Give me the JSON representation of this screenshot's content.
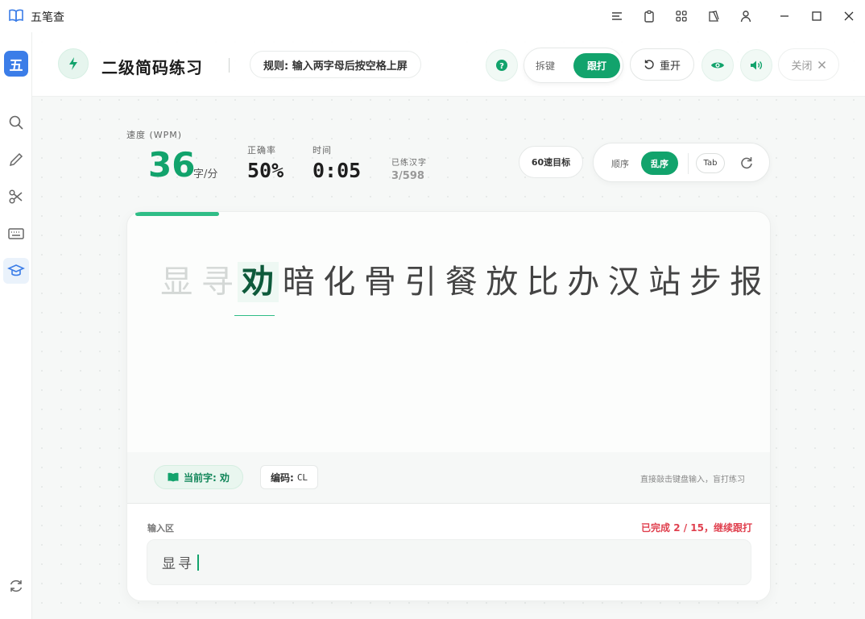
{
  "app": {
    "title": "五笔查"
  },
  "sidebar": {
    "logo_text": "五"
  },
  "header": {
    "title": "二级简码练习",
    "rule": "规则: 输入两字母后按空格上屏",
    "mode_off": "拆键",
    "mode_on": "跟打",
    "restart": "重开",
    "close": "关闭"
  },
  "stats": {
    "speed_label": "速度 (WPM)",
    "speed_value": "36",
    "speed_unit": "字/分",
    "accuracy_label": "正确率",
    "accuracy_value": "50%",
    "time_label": "时间",
    "time_value": "0:05",
    "practiced_label": "已练汉字",
    "practiced_value": "3/598"
  },
  "controls": {
    "target": "60速目标",
    "order_off": "顺序",
    "order_on": "乱序",
    "tab": "Tab"
  },
  "practice": {
    "progress": 0.133,
    "chars": [
      "显",
      "寻",
      "劝",
      "暗",
      "化",
      "骨",
      "引",
      "餐",
      "放",
      "比",
      "办",
      "汉",
      "站",
      "步",
      "报"
    ],
    "done_count": 2,
    "current_index": 2,
    "current_char_label": "当前字: 劝",
    "code_label": "编码:",
    "code_value": "CL",
    "hint": "直接敲击键盘输入，盲打练习",
    "input_label": "输入区",
    "status": "已完成 2 / 15，继续跟打",
    "input_value": "显寻"
  },
  "colors": {
    "accent": "#12a36c",
    "error": "#e0414f",
    "brand": "#3b7de8"
  }
}
